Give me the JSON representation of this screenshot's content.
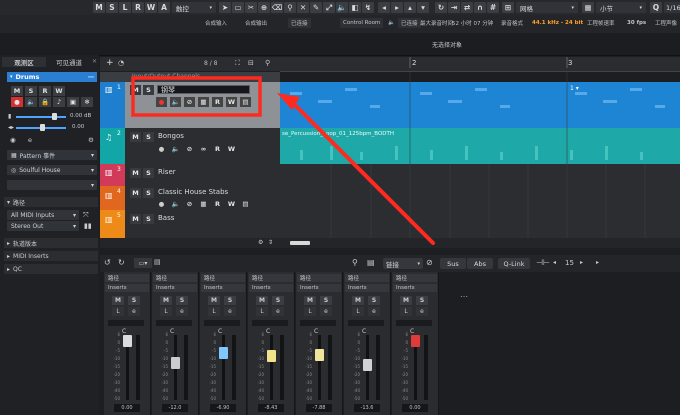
{
  "toolbar": {
    "mode_buttons": [
      "M",
      "S",
      "L",
      "R",
      "W",
      "A"
    ],
    "automation_mode": "触控",
    "snap_mode": "网格",
    "grid_value": "小节",
    "quantize": "1/16"
  },
  "info_bar": {
    "input": "合成输入",
    "output": "合成输出",
    "connected1": "已连接",
    "control_room": "Control Room",
    "connected2": "已连接",
    "max_record": "最大录音时间",
    "record_time": "52 小时 07 分钟",
    "record_format_label": "录音格式",
    "record_format": "44.1 kHz - 24 bit",
    "frame_rate_label": "工程帧速率",
    "frame_rate": "30 fps",
    "pan_label": "工程声像"
  },
  "status": {
    "no_object": "无选择对象"
  },
  "inspector": {
    "tab1": "观测区",
    "tab2": "可见通道",
    "track_name": "Drums",
    "volume_value": "0.00",
    "pan_value": "0.00",
    "db": "dB",
    "pattern_label": "Pattern 事件",
    "kit_name": "Soulful House",
    "routing_label": "路径",
    "midi_input": "All MIDI Inputs",
    "output": "Stereo Out",
    "track_version": "轨道版本",
    "midi_inserts": "MIDI Inserts",
    "qc": "QC"
  },
  "project": {
    "counter": "8 / 8",
    "bars": [
      "2",
      "3"
    ],
    "tracks": [
      {
        "num": "1",
        "name": "钢琴",
        "color": "#1e7fcf"
      },
      {
        "num": "2",
        "name": "Bongos",
        "color": "#12a7a6"
      },
      {
        "num": "3",
        "name": "Riser",
        "color": "#d23a5a"
      },
      {
        "num": "4",
        "name": "Classic House Stabs",
        "color": "#e0671d"
      },
      {
        "num": "5",
        "name": "Bass",
        "color": "#ee8a17"
      }
    ],
    "folder_name": "Input/Output Channels",
    "bongos_event": "se_Percussion_Loop_01_125bpm_BODTH",
    "track_buttons": {
      "m": "M",
      "s": "S",
      "r": "R",
      "w": "W"
    }
  },
  "mixer": {
    "link_label": "链接",
    "sus": "Sus",
    "abs": "Abs",
    "qlink": "Q-Link",
    "zoom_value": "15",
    "route_label": "路径",
    "insert_label": "Inserts",
    "strips": [
      {
        "value": "0.00",
        "fader_color": "#d9dbde"
      },
      {
        "value": "-12.0",
        "fader_color": "#c9ccd0"
      },
      {
        "value": "-6.90",
        "fader_color": "#7fc8ff"
      },
      {
        "value": "-8.43",
        "fader_color": "#f2e28a"
      },
      {
        "value": "-7.88",
        "fader_color": "#f0e49a"
      },
      {
        "value": "-13.6",
        "fader_color": "#cfd2d6"
      },
      {
        "value": "0.00",
        "fader_color": "#e03a3a"
      }
    ],
    "scale": [
      "6",
      "0",
      "-5",
      "-10",
      "-15",
      "-20",
      "-30",
      "-40",
      "-50",
      "-60"
    ]
  }
}
